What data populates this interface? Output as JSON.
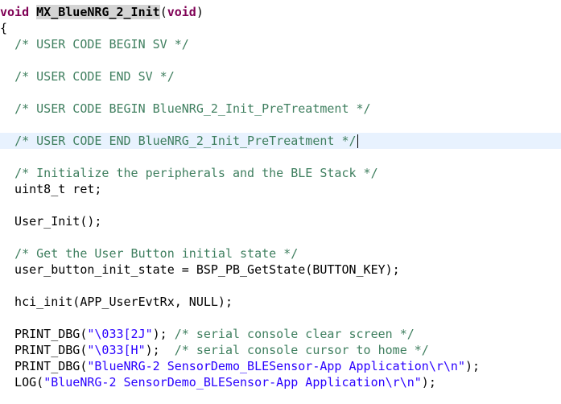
{
  "editor": {
    "line_highlight_color": "#e8f2fe",
    "colors": {
      "keyword": "#7f0055",
      "comment": "#3f7f5f",
      "string": "#2a00ff",
      "text": "#000000"
    },
    "lines": {
      "l1": {
        "kw1": "void",
        "sp1": " ",
        "fn": "MX_BlueNRG_2_Init",
        "p1": "(",
        "kw2": "void",
        "p2": ")"
      },
      "l2": {
        "text": "{"
      },
      "l3": {
        "indent": "  ",
        "comment": "/* USER CODE BEGIN SV */"
      },
      "l4": {
        "indent": "  ",
        "comment": "/* USER CODE END SV */"
      },
      "l5": {
        "indent": "  ",
        "comment": "/* USER CODE BEGIN BlueNRG_2_Init_PreTreatment */"
      },
      "l6": {
        "indent": "  ",
        "comment": "/* USER CODE END BlueNRG_2_Init_PreTreatment */"
      },
      "l7": {
        "indent": "  ",
        "comment": "/* Initialize the peripherals and the BLE Stack */"
      },
      "l8": {
        "text": "  uint8_t ret;"
      },
      "l9": {
        "text": "  User_Init();"
      },
      "l10": {
        "indent": "  ",
        "comment": "/* Get the User Button initial state */"
      },
      "l11": {
        "text": "  user_button_init_state = BSP_PB_GetState(BUTTON_KEY);"
      },
      "l12": {
        "text": "  hci_init(APP_UserEvtRx, NULL);"
      },
      "l13": {
        "pre": "  PRINT_DBG(",
        "str": "\"\\033[2J\"",
        "post": "); ",
        "comment": "/* serial console clear screen */"
      },
      "l14": {
        "pre": "  PRINT_DBG(",
        "str": "\"\\033[H\"",
        "post": ");  ",
        "comment": "/* serial console cursor to home */"
      },
      "l15": {
        "pre": "  PRINT_DBG(",
        "str": "\"BlueNRG-2 SensorDemo_BLESensor-App Application\\r\\n\"",
        "post": ");"
      },
      "l16": {
        "pre": "  LOG(",
        "str": "\"BlueNRG-2 SensorDemo_BLESensor-App Application\\r\\n\"",
        "post": ");"
      }
    }
  }
}
